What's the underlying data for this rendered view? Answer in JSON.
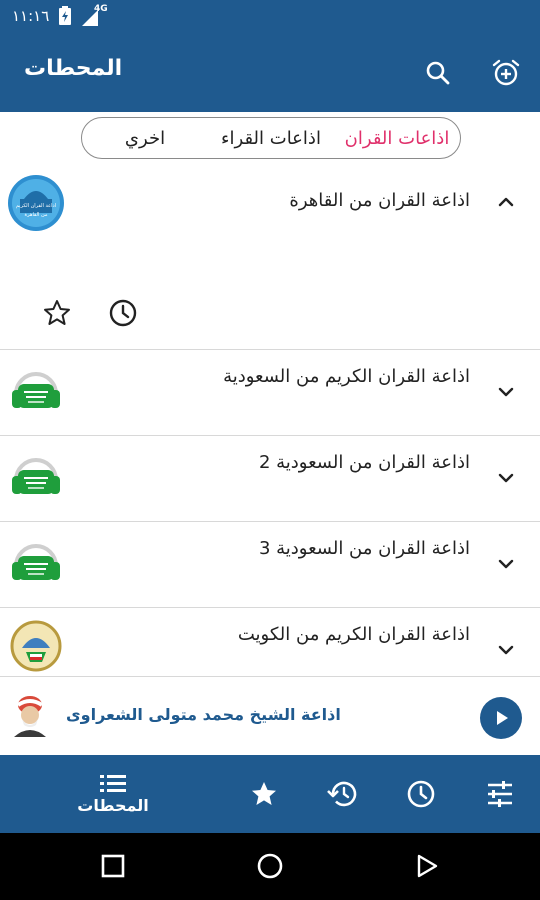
{
  "status": {
    "time": "١١:١٦",
    "network": "4G"
  },
  "appbar": {
    "title": "المحطات"
  },
  "tabs": [
    {
      "label": "اذاعات القران",
      "active": true
    },
    {
      "label": "اذاعات القراء",
      "active": false
    },
    {
      "label": "اخري",
      "active": false
    }
  ],
  "stations": [
    {
      "title": "اذاعة القران  من القاهرة",
      "expanded": true,
      "logo_text": "اذاعة القرآن الكريم",
      "logo_sub": "من القاهرة"
    },
    {
      "title": "اذاعة القران الكريم من السعودية",
      "expanded": false
    },
    {
      "title": "اذاعة القران من السعودية 2",
      "expanded": false
    },
    {
      "title": "اذاعة القران من السعودية 3",
      "expanded": false
    },
    {
      "title": "اذاعة القران الكريم من الكويت",
      "expanded": false
    }
  ],
  "now_playing": {
    "title": "اذاعة الشيخ محمد متولى الشعراوى"
  },
  "bottom_nav": {
    "stations_label": "المحطات"
  },
  "colors": {
    "primary": "#1f5a8f",
    "accent": "#e0306b",
    "saudi_green": "#1f9e3c"
  },
  "icons": [
    "add-alarm-icon",
    "search-icon",
    "star-outline-icon",
    "clock-icon",
    "chevron-up-icon",
    "chevron-down-icon",
    "play-icon",
    "list-icon",
    "star-icon",
    "history-icon",
    "sliders-icon",
    "square-icon",
    "circle-icon",
    "triangle-back-icon"
  ]
}
